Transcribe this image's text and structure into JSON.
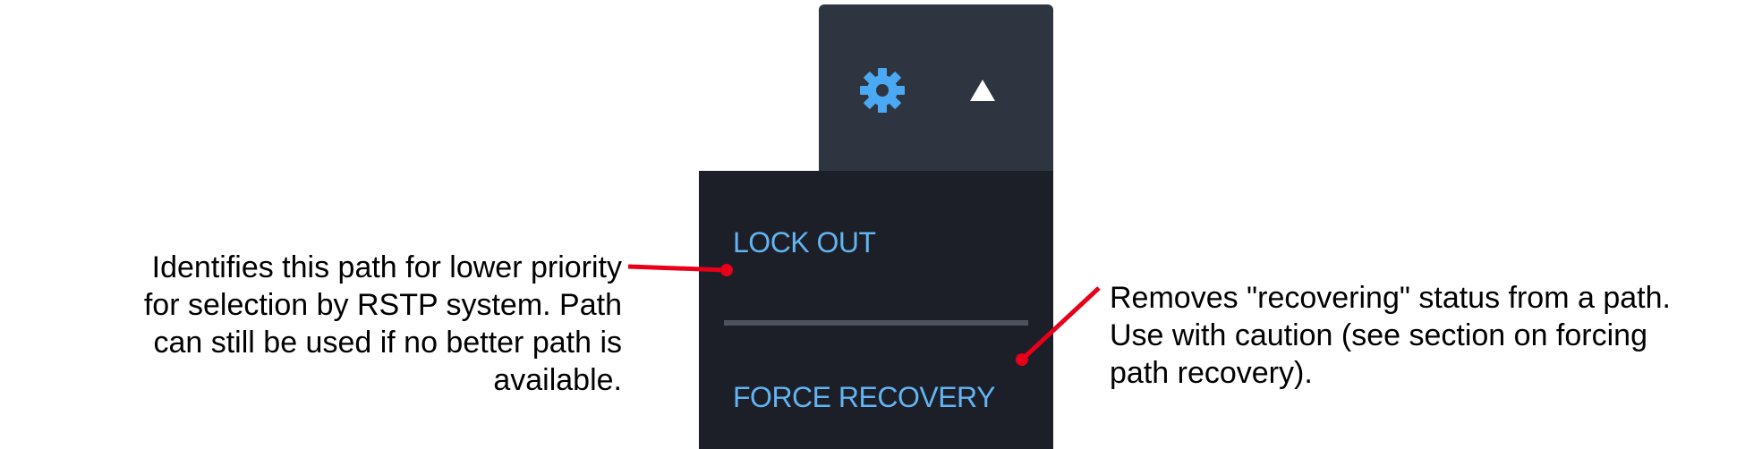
{
  "colors": {
    "header_bg": "#2f3540",
    "menu_bg": "#1c1f27",
    "accent_blue": "#4aa9f2",
    "menu_text": "#62b4f2",
    "divider": "#4c535f",
    "leader_red": "#e8001a"
  },
  "header": {
    "gear_icon": "gear-icon",
    "toggle_icon": "triangle-up-icon"
  },
  "menu": {
    "items": [
      {
        "label": "LOCK OUT"
      },
      {
        "label": "FORCE RECOVERY"
      }
    ]
  },
  "annotations": {
    "lock_out": {
      "lines": [
        "Identifies this path for lower priority",
        "for selection by RSTP system. Path",
        "can still be used if no better path is",
        "available."
      ]
    },
    "force_recovery": {
      "lines": [
        "Removes \"recovering\" status from a path.",
        "Use with caution (see section on forcing",
        "path recovery)."
      ]
    }
  }
}
